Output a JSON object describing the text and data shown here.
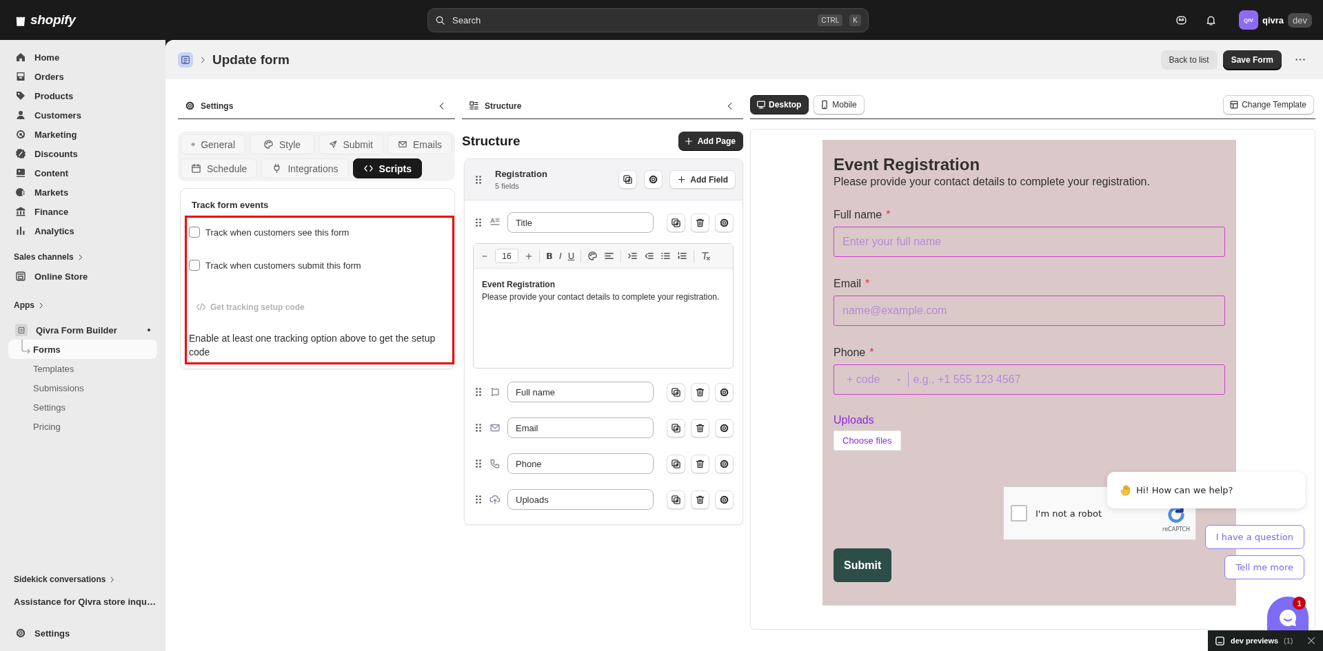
{
  "topbar": {
    "logo": "shopify",
    "search": {
      "placeholder": "Search"
    },
    "shortcut": [
      "CTRL",
      "K"
    ],
    "user": {
      "initials": "QIV",
      "name": "qivra",
      "tag": "dev"
    }
  },
  "sidebar": {
    "items": [
      {
        "label": "Home"
      },
      {
        "label": "Orders"
      },
      {
        "label": "Products"
      },
      {
        "label": "Customers"
      },
      {
        "label": "Marketing"
      },
      {
        "label": "Discounts"
      },
      {
        "label": "Content"
      },
      {
        "label": "Markets"
      },
      {
        "label": "Finance"
      },
      {
        "label": "Analytics"
      }
    ],
    "sales_channels": {
      "heading": "Sales channels",
      "items": [
        {
          "label": "Online Store"
        }
      ]
    },
    "apps": {
      "heading": "Apps",
      "app": {
        "label": "Qivra Form Builder",
        "children": [
          {
            "label": "Forms",
            "selected": true
          },
          {
            "label": "Templates",
            "selected": false
          },
          {
            "label": "Submissions",
            "selected": false
          },
          {
            "label": "Settings",
            "selected": false
          },
          {
            "label": "Pricing",
            "selected": false
          }
        ]
      }
    },
    "sidekick": {
      "heading": "Sidekick conversations",
      "items": [
        {
          "label": "Assistance for Qivra store inqu…"
        }
      ]
    },
    "footer": {
      "label": "Settings"
    }
  },
  "header": {
    "title": "Update form",
    "buttons": [
      {
        "label": "Back to list",
        "kind": "secondary"
      },
      {
        "label": "Save Form",
        "kind": "primary"
      }
    ]
  },
  "settings_panel": {
    "title": "Settings",
    "tabs": [
      {
        "label": "General",
        "selected": false
      },
      {
        "label": "Style",
        "selected": false
      },
      {
        "label": "Submit",
        "selected": false
      },
      {
        "label": "Emails",
        "selected": false
      },
      {
        "label": "Schedule",
        "selected": false
      },
      {
        "label": "Integrations",
        "selected": false
      },
      {
        "label": "Scripts",
        "selected": true
      }
    ],
    "card": {
      "heading": "Track form events",
      "options": [
        {
          "label": "Track when customers see this form",
          "checked": false
        },
        {
          "label": "Track when customers submit this form",
          "checked": false
        }
      ],
      "code_link": {
        "label": "Get tracking setup code",
        "disabled": true
      },
      "hint": "Enable at least one tracking option above to get the setup code"
    }
  },
  "structure_panel": {
    "title": "Structure",
    "heading": "Structure",
    "add_page": "Add Page",
    "page": {
      "name": "Registration",
      "count": "5 fields",
      "add_field": "Add Field",
      "fields": [
        {
          "label": "Title",
          "kind": "text",
          "expanded": true,
          "editor": {
            "font_size": "16",
            "format_buttons": [
              "B",
              "I",
              "U"
            ],
            "heading": "Event Registration",
            "body": "Please provide your contact details to complete your registration."
          }
        },
        {
          "label": "Full name",
          "kind": "input"
        },
        {
          "label": "Email",
          "kind": "email"
        },
        {
          "label": "Phone",
          "kind": "phone"
        },
        {
          "label": "Uploads",
          "kind": "upload"
        }
      ]
    }
  },
  "preview_panel": {
    "tabs": [
      {
        "label": "Desktop",
        "selected": true
      },
      {
        "label": "Mobile",
        "selected": false
      }
    ],
    "change_template": "Change Template",
    "form": {
      "title": "Event Registration",
      "subtitle": "Please provide your contact details to complete your registration.",
      "fields": [
        {
          "kind": "text",
          "label": "Full name",
          "required_mark": "*",
          "placeholder": "Enter your full name"
        },
        {
          "kind": "text",
          "label": "Email",
          "required_mark": "*",
          "placeholder": "name@example.com"
        },
        {
          "kind": "phone",
          "label": "Phone",
          "required_mark": "*",
          "code_placeholder": "+ code",
          "placeholder": "e.g., +1 555 123 4567"
        },
        {
          "kind": "upload",
          "label": "Uploads",
          "button": "Choose files"
        }
      ],
      "captcha": {
        "label": "I'm not a robot",
        "brand": "reCAPTCH",
        "checked": false
      },
      "submit": "Submit"
    }
  },
  "chat": {
    "greeting": "Hi! How can we help?",
    "replies": [
      "I have a question",
      "Tell me more"
    ],
    "badge": "1"
  },
  "dev_bar": {
    "label": "dev previews",
    "count": "(1)"
  }
}
